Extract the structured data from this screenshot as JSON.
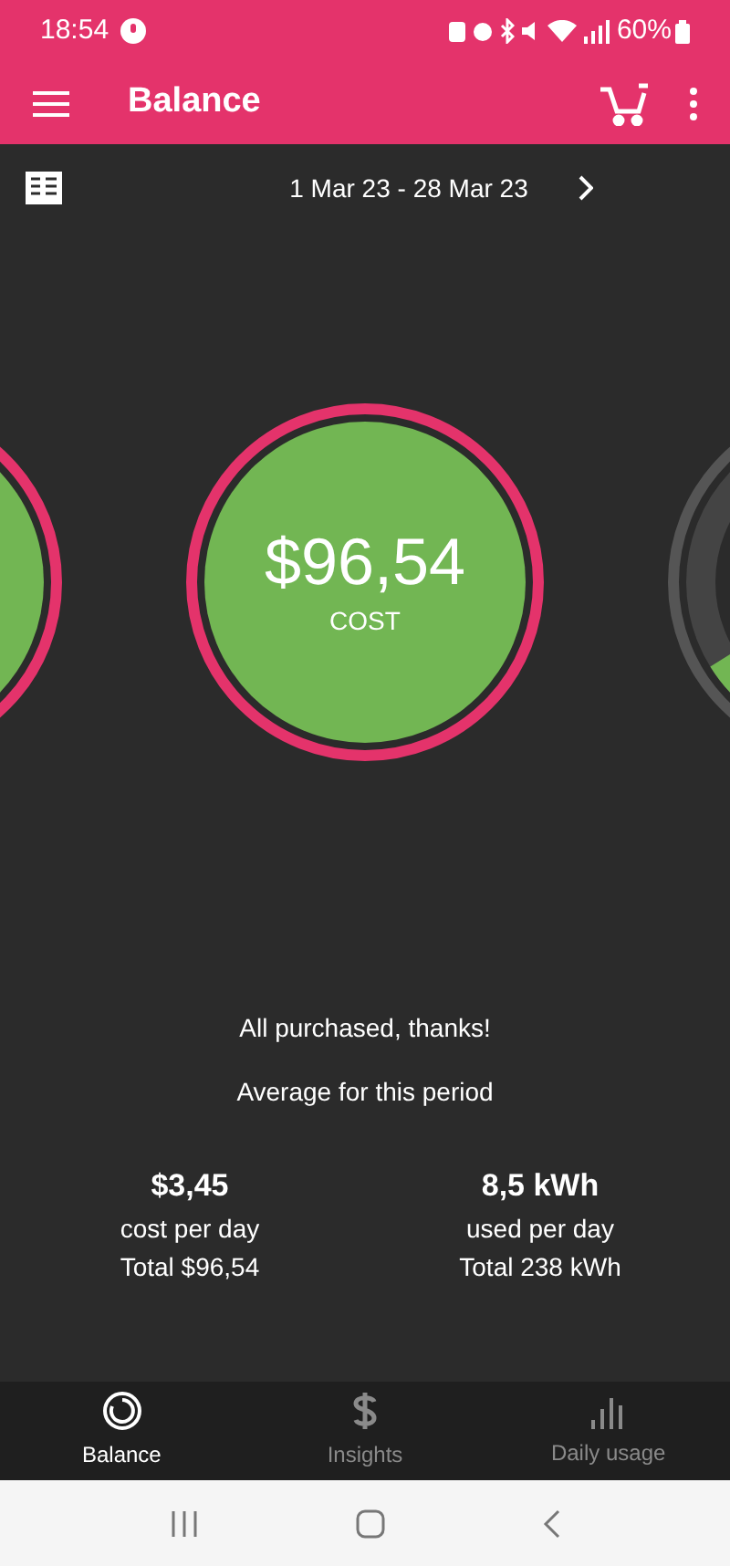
{
  "status_bar": {
    "time": "18:54",
    "battery": "60%"
  },
  "header": {
    "title": "Balance"
  },
  "period": {
    "label": "1 Mar 23 - 28 Mar 23"
  },
  "dials": [
    {
      "kind": "cost"
    },
    {
      "kind": "cost",
      "value": "$96,54",
      "caption": "COST"
    },
    {
      "kind": "gauge"
    }
  ],
  "messages": [
    "All purchased, thanks!",
    "Average for this period"
  ],
  "stats": [
    {
      "value": "$3,45",
      "unit": "cost per day",
      "total": "Total $96,54"
    },
    {
      "value": "8,5 kWh",
      "unit": "used per day",
      "total": "Total 238 kWh"
    }
  ],
  "nav": [
    {
      "label": "Balance",
      "selected": true
    },
    {
      "label": "Insights",
      "selected": false
    },
    {
      "label": "Daily usage",
      "selected": false
    }
  ]
}
